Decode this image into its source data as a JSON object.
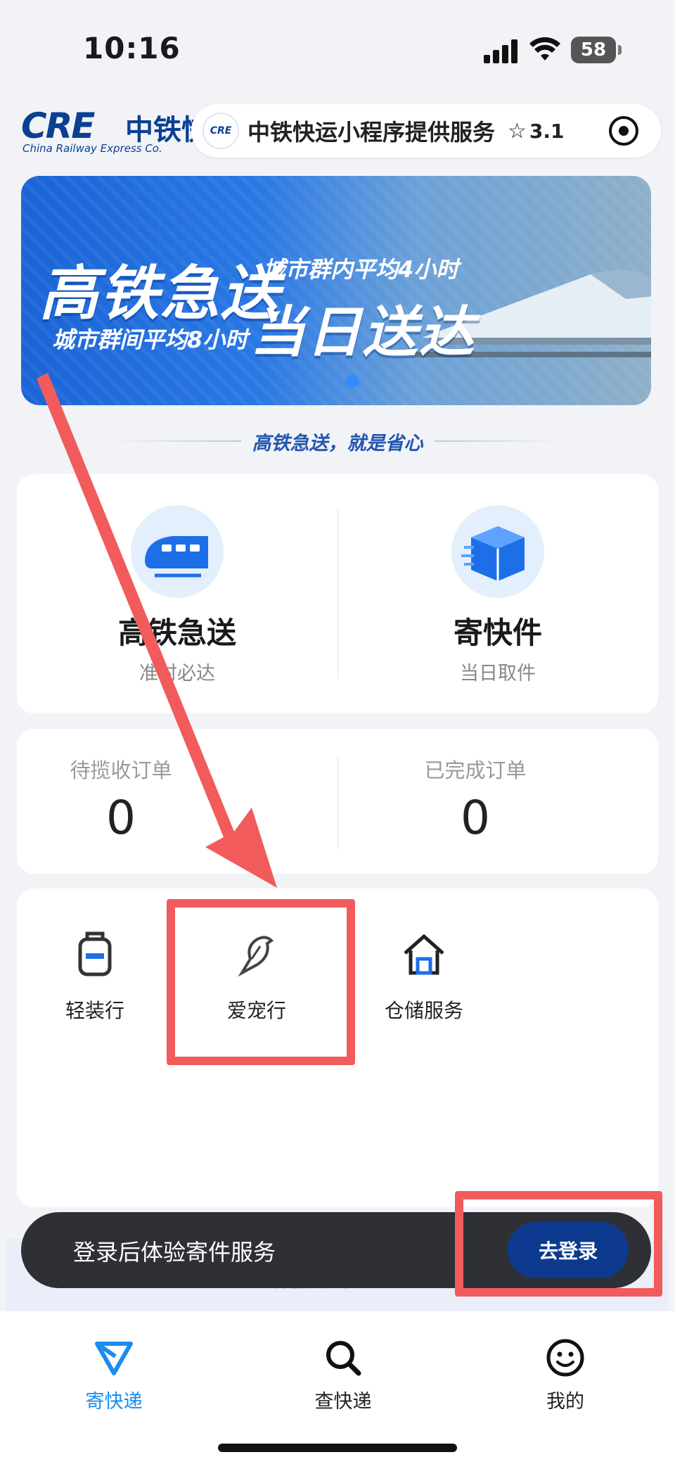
{
  "status_bar": {
    "time": "10:16",
    "battery": "58"
  },
  "header": {
    "logo_mark": "CRE",
    "logo_cn": "中铁快",
    "logo_en": "China Railway Express Co.",
    "mini_program_title": "中铁快运小程序提供服务",
    "rating": "3.1"
  },
  "banner": {
    "title_left": "高铁急送",
    "title_right": "当日送达",
    "subtitle_top": "城市群内平均4小时",
    "subtitle_bottom": "城市群间平均8小时"
  },
  "slogan": "高铁急送，就是省心",
  "services": [
    {
      "title": "高铁急送",
      "subtitle": "准时必达"
    },
    {
      "title": "寄快件",
      "subtitle": "当日取件"
    }
  ],
  "orders": [
    {
      "label": "待揽收订单",
      "count": "0"
    },
    {
      "label": "已完成订单",
      "count": "0"
    }
  ],
  "extras": [
    {
      "label": "轻装行",
      "icon": "backpack-icon"
    },
    {
      "label": "爱宠行",
      "icon": "bird-icon"
    },
    {
      "label": "仓储服务",
      "icon": "warehouse-icon"
    }
  ],
  "hotline": "客服热线: 95572",
  "toast": {
    "text": "登录后体验寄件服务",
    "button": "去登录"
  },
  "tabbar": [
    {
      "label": "寄快递",
      "icon": "send-icon",
      "active": true
    },
    {
      "label": "查快递",
      "icon": "search-icon",
      "active": false
    },
    {
      "label": "我的",
      "icon": "smiley-icon",
      "active": false
    }
  ],
  "colors": {
    "brand_blue": "#0b3f92",
    "accent_blue": "#1a8cf0",
    "annotation_red": "#f25b5b",
    "toast_bg": "#2e3036"
  }
}
